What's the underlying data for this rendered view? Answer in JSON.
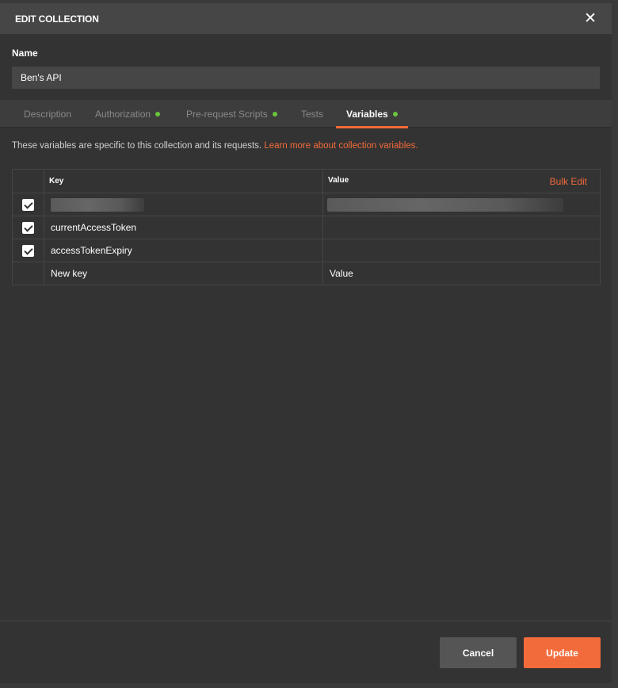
{
  "dialog": {
    "title": "EDIT COLLECTION"
  },
  "name_field": {
    "label": "Name",
    "value": "Ben's API"
  },
  "tabs": [
    {
      "label": "Description",
      "dot": false,
      "active": false
    },
    {
      "label": "Authorization",
      "dot": true,
      "active": false
    },
    {
      "label": "Pre-request Scripts",
      "dot": true,
      "active": false
    },
    {
      "label": "Tests",
      "dot": false,
      "active": false
    },
    {
      "label": "Variables",
      "dot": true,
      "active": true
    }
  ],
  "intro": {
    "text": "These variables are specific to this collection and its requests.",
    "link": "Learn more about collection variables."
  },
  "table": {
    "headers": {
      "key": "Key",
      "value": "Value",
      "bulk_edit": "Bulk Edit"
    },
    "rows": [
      {
        "checked": true,
        "key": "",
        "value": "",
        "redacted": true
      },
      {
        "checked": true,
        "key": "currentAccessToken",
        "value": ""
      },
      {
        "checked": true,
        "key": "accessTokenExpiry",
        "value": ""
      }
    ],
    "new_row": {
      "key_placeholder": "New key",
      "value_placeholder": "Value"
    }
  },
  "footer": {
    "cancel_label": "Cancel",
    "update_label": "Update"
  },
  "colors": {
    "accent": "#f26b3a",
    "dot": "#6ac53d",
    "background": "#333333",
    "header": "#464646"
  }
}
